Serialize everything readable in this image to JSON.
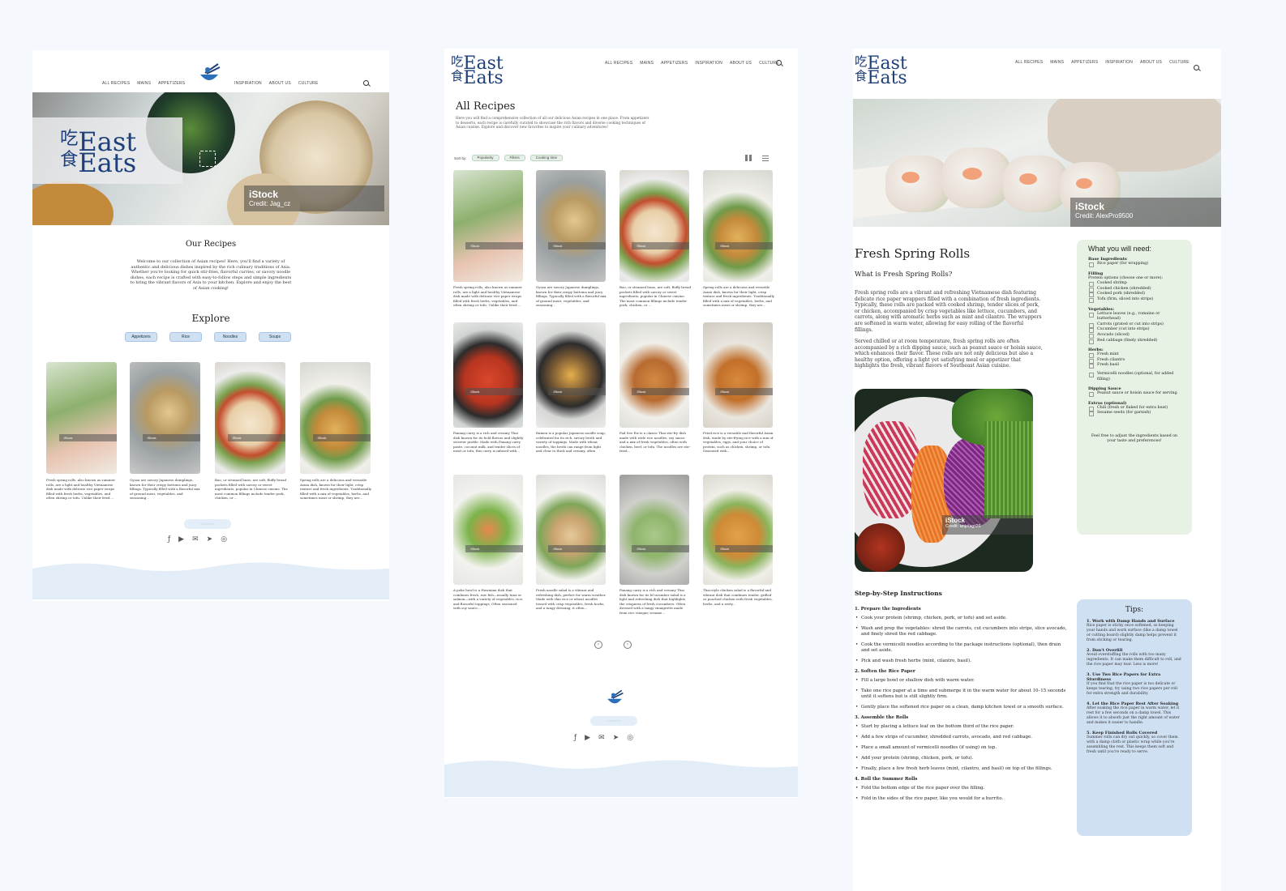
{
  "nav": {
    "all_recipes": "ALL RECIPES",
    "mains": "MAINS",
    "appetizers": "APPETIZERS",
    "inspiration": "INSPIRATION",
    "about_us": "ABOUT US",
    "culture": "CULTURE"
  },
  "logo": {
    "line1": "East",
    "line2": "Eats"
  },
  "home": {
    "hero_credit_title": "iStock",
    "hero_credit": "Credit: Jag_cz",
    "our_recipes_title": "Our Recipes",
    "our_recipes_text": "Welcome to our collection of Asian recipes! Here, you'll find a variety of authentic and delicious dishes inspired by the rich culinary traditions of Asia. Whether you're looking for quick stir-fries, flavorful curries, or savory noodle dishes, each recipe is crafted with easy-to-follow steps and simple ingredients to bring the vibrant flavors of Asia to your kitchen. Explore and enjoy the best of Asian cooking!",
    "explore_title": "Explore",
    "explore_pills": [
      "Appetizers",
      "Rice",
      "Noodles",
      "Soups"
    ],
    "cards": [
      {
        "tag": "iStock",
        "text": "Fresh spring rolls, also known as summer rolls, are a light and healthy Vietnamese dish made with delicate rice paper wraps filled with fresh herbs, vegetables, and often shrimp or tofu. Unlike their fried ..."
      },
      {
        "tag": "iStock",
        "text": "Gyoza are savory Japanese dumplings, known for their crispy bottoms and juicy fillings. Typically filled with a flavorful mix of ground meat, vegetables, and seasoning..."
      },
      {
        "tag": "iStock",
        "text": "Bao, or steamed buns, are soft, fluffy bread pockets filled with savory or sweet ingredients, popular in Chinese cuisine. The most common fillings include tender pork, chicken, or ..."
      },
      {
        "tag": "iStock",
        "text": "Spring rolls are a delicious and versatile Asian dish, known for their light, crisp texture and fresh ingredients. Traditionally filled with a mix of vegetables, herbs, and sometimes meat or shrimp, they are..."
      }
    ],
    "subscribe_label": "Subscribe"
  },
  "all_recipes": {
    "title": "All Recipes",
    "intro": "Here you will find a comprehensive collection of all our delicious Asian recipes in one place. From appetizers to desserts, each recipe is carefully curated to showcase the rich flavors and diverse cooking techniques of Asian cuisine. Explore and discover new favorites to inspire your culinary adventures!",
    "sort_label": "Sort by:",
    "sort_popularity": "Popularity",
    "sort_filters": "Filters",
    "sort_time": "Cooking time",
    "cards": [
      {
        "tag": "iStock",
        "text": "Fresh spring rolls, also known as summer rolls, are a light and healthy Vietnamese dish made with delicate rice paper wraps filled with fresh herbs, vegetables, and often shrimp or tofu. Unlike their fried ..."
      },
      {
        "tag": "iStock",
        "text": "Gyoza are savory Japanese dumplings, known for their crispy bottoms and juicy fillings. Typically filled with a flavorful mix of ground meat, vegetables, and seasoning..."
      },
      {
        "tag": "iStock",
        "text": "Bao, or steamed buns, are soft, fluffy bread pockets filled with savory or sweet ingredients, popular in Chinese cuisine. The most common fillings include tender pork, chicken, or ..."
      },
      {
        "tag": "iStock",
        "text": "Spring rolls are a delicious and versatile Asian dish, known for their light, crisp texture and fresh ingredients. Traditionally filled with a mix of vegetables, herbs, and sometimes meat or shrimp, they are..."
      },
      {
        "tag": "iStock",
        "text": "Panang curry is a rich and creamy Thai dish known for its bold flavors and slightly sweeter profile. Made with Panang curry paste, coconut milk, and tender slices of meat or tofu, this curry is infused with..."
      },
      {
        "tag": "iStock",
        "text": "Ramen is a popular Japanese noodle soup, celebrated for its rich, savory broth and variety of toppings. Made with wheat noodles, the broth can range from light and clear to thick and creamy, often flavored with soy..."
      },
      {
        "tag": "iStock",
        "text": "Pad See Ew is a classic Thai stir-fry dish made with wide rice noodles, soy sauce, and a mix of fresh vegetables, often with chicken, beef, or tofu. The noodles are stir-fried..."
      },
      {
        "tag": "iStock",
        "text": "Fried rice is a versatile and flavorful Asian dish, made by stir-frying rice with a mix of vegetables, eggs, and your choice of protein, such as chicken, shrimp, or tofu. Seasoned with..."
      },
      {
        "tag": "iStock",
        "text": "A poke bowl is a Hawaiian dish that combines fresh, raw fish—usually tuna or salmon—with a variety of vegetables, rice, and flavorful toppings. Often seasoned with soy sauce,..."
      },
      {
        "tag": "iStock",
        "text": "Fresh noodle salad is a vibrant and refreshing dish, perfect for warm weather. Made with thin rice or wheat noodles tossed with crisp vegetables, fresh herbs, and a tangy dressing, it often..."
      },
      {
        "tag": "iStock",
        "text": "Panang curry is a rich and creamy Thai dish known for its bCucumber salad is a light and refreshing dish that highlights the crispness of fresh cucumbers. Often dressed with a tangy vinaigrette made from rice vinegar, sesame..."
      },
      {
        "tag": "iStock",
        "text": "Thai-style chicken salad is a flavorful and vibrant dish that combines tender, grilled or poached chicken with fresh vegetables, herbs, and a zesty..."
      }
    ],
    "subscribe_label": "Subscribe"
  },
  "detail": {
    "hero_credit_title": "iStock",
    "hero_credit": "Credit: AlexPro9500",
    "title": "Fresh Spring Rolls",
    "subtitle": "What is Fresh Spring Rolls?",
    "para1": "Fresh spring rolls are a vibrant and refreshing Vietnamese dish featuring delicate rice paper wrappers filled with a combination of fresh ingredients. Typically, these rolls are packed with cooked shrimp, tender slices of pork, or chicken, accompanied by crisp vegetables like lettuce, cucumbers, and carrots, along with aromatic herbs such as mint and cilantro. The wrappers are softened in warm water, allowing for easy rolling of the flavorful fillings.",
    "para2": "Served chilled or at room temperature, fresh spring rolls are often accompanied by a rich dipping sauce, such as peanut sauce or hoisin sauce, which enhances their flavor. These rolls are not only delicious but also a healthy option, offering a light yet satisfying meal or appetizer that highlights the fresh, vibrant flavors of Southeast Asian cuisine.",
    "food_credit_title": "iStock",
    "food_credit": "Credit: anjelagr26",
    "ingredients": {
      "title": "What you will need:",
      "base_head": "Base Ingredients",
      "base": [
        "Rice paper (for wrapping)"
      ],
      "filling_head": "Filling",
      "filling_note": "Protein options (choose one or more):",
      "filling": [
        "Cooked shrimp",
        "Cooked chicken (shredded)",
        "Cooked pork (shredded)",
        "Tofu (firm, sliced into strips)"
      ],
      "veg_head": "Vegetables:",
      "veg": [
        "Lettuce leaves (e.g., romaine or butterhead)",
        "Carrots (grated or cut into strips)",
        "Cucumber (cut into strips)",
        "Avocado (sliced)",
        "Red cabbage (finely shredded)"
      ],
      "herbs_head": "Herbs:",
      "herbs": [
        "Fresh mint",
        "Fresh cilantro",
        "Fresh basil"
      ],
      "noodles": "Vermicelli noodles (optional, for added filling)",
      "sauce_head": "Dipping Sauce",
      "sauce": [
        "Peanut sauce or hoisin sauce for serving."
      ],
      "extras_head": "Extras (optional)",
      "extras": [
        "Chili (fresh or flaked for extra heat)",
        "Sesame seeds (for garnish)"
      ],
      "note": "Feel free to adjust the ingredients based on your taste and preferences!"
    },
    "steps_title": "Step-by-Step Instructions",
    "steps": [
      {
        "head": "1. Prepare the Ingredients",
        "items": [
          "Cook your protein (shrimp, chicken, pork, or tofu) and set aside.",
          "Wash and prep the vegetables: shred the carrots, cut cucumbers into strips, slice avocado, and finely shred the red cabbage.",
          "Cook the vermicelli noodles according to the package instructions (optional), then drain and set aside.",
          "Pick and wash fresh herbs (mint, cilantro, basil)."
        ]
      },
      {
        "head": "2. Soften the Rice Paper",
        "items": [
          "Fill a large bowl or shallow dish with warm water.",
          "Take one rice paper at a time and submerge it in the warm water for about 10–15 seconds until it softens but is still slightly firm.",
          "Gently place the softened rice paper on a clean, damp kitchen towel or a smooth surface."
        ]
      },
      {
        "head": "3. Assemble the Rolls",
        "items": [
          "Start by placing a lettuce leaf on the bottom third of the rice paper.",
          "Add a few strips of cucumber, shredded carrots, avocado, and red cabbage.",
          "Place a small amount of vermicelli noodles (if using) on top.",
          "Add your protein (shrimp, chicken, pork, or tofu).",
          "Finally, place a few fresh herb leaves (mint, cilantro, and basil) on top of the fillings."
        ]
      },
      {
        "head": "4. Roll the Summer Rolls",
        "items": [
          "Fold the bottom edge of the rice paper over the filling.",
          "Fold in the sides of the rice paper, like you would for a burrito."
        ]
      }
    ],
    "tips_title": "Tips:",
    "tips": [
      {
        "head": "1. Work with Damp Hands and Surface",
        "body": "Rice paper is sticky once softened, so keeping your hands and work surface (like a damp towel or cutting board) slightly damp helps prevent it from sticking or tearing."
      },
      {
        "head": "2. Don't Overfill",
        "body": "Avoid overstuffing the rolls with too many ingredients. It can make them difficult to roll, and the rice paper may tear. Less is more!"
      },
      {
        "head": "3. Use Two Rice Papers for Extra Sturdiness",
        "body": "If you find that the rice paper is too delicate or keeps tearing, try using two rice papers per roll for extra strength and durability."
      },
      {
        "head": "4. Let the Rice Paper Rest After Soaking",
        "body": "After soaking the rice paper in warm water, let it rest for a few seconds on a damp towel. This allows it to absorb just the right amount of water and makes it easier to handle."
      },
      {
        "head": "5. Keep Finished Rolls Covered",
        "body": "Summer rolls can dry out quickly, so cover them with a damp cloth or plastic wrap while you're assembling the rest. This keeps them soft and fresh until you're ready to serve."
      }
    ]
  },
  "colors": {
    "brand": "#1d3f7a",
    "accent": "#2a6fb8",
    "ingredients_bg": "#e7f1e4",
    "tips_bg": "#cfe0f2"
  }
}
